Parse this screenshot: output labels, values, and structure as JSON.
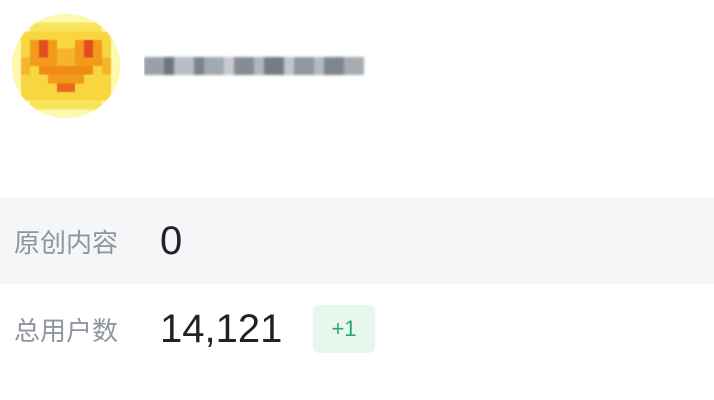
{
  "account": {
    "avatar_icon": "avatar-icon",
    "name_text": ""
  },
  "stats": {
    "original_content": {
      "label": "原创内容",
      "value": "0"
    },
    "total_users": {
      "label": "总用户数",
      "value": "14,121",
      "change": "+1"
    }
  },
  "colors": {
    "label": "#8f959e",
    "value": "#1f2329",
    "row_highlight": "#f5f6f8",
    "badge_bg": "#e8f7ee",
    "badge_text": "#2ba471",
    "avatar_yellow": "#f7e45a",
    "avatar_orange": "#f29a1a",
    "avatar_red": "#e34c1d"
  }
}
